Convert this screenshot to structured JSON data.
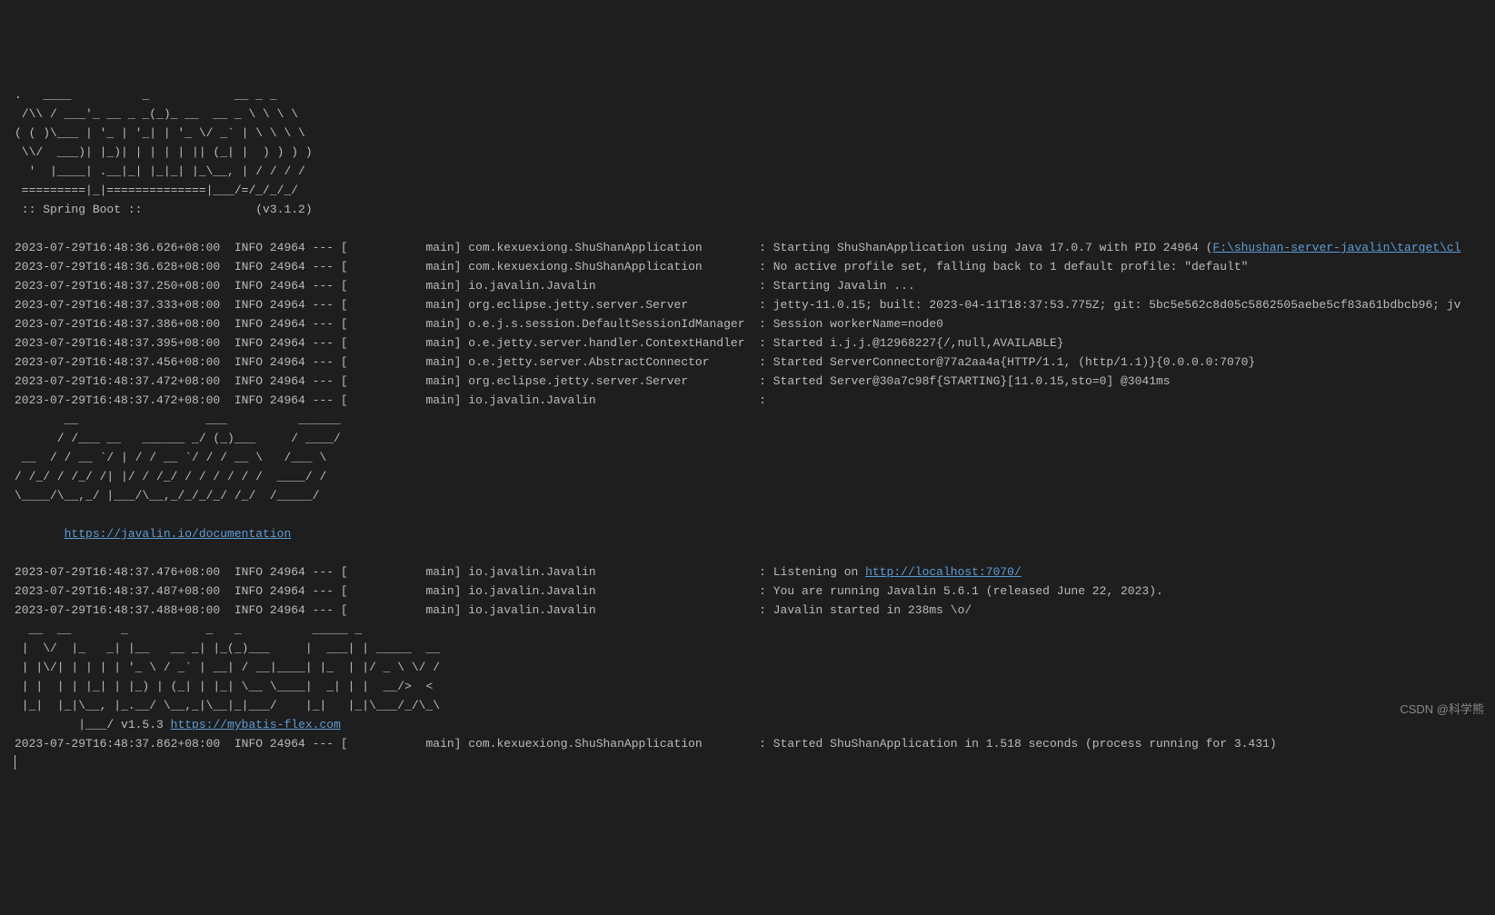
{
  "banner_spring_top": ".   ____          _            __ _ _\n /\\\\ / ___'_ __ _ _(_)_ __  __ _ \\ \\ \\ \\\n( ( )\\___ | '_ | '_| | '_ \\/ _` | \\ \\ \\ \\\n \\\\/  ___)| |_)| | | | | || (_| |  ) ) ) )\n  '  |____| .__|_| |_|_| |_\\__, | / / / /\n =========|_|==============|___/=/_/_/_/",
  "banner_spring_version": " :: Spring Boot ::                (v3.1.2)",
  "log_line_1_prefix": "2023-07-29T16:48:36.626+08:00  INFO 24964 --- [           main] com.kexuexiong.ShuShanApplication        : Starting ShuShanApplication using Java 17.0.7 with PID 24964 (",
  "log_line_1_link": "F:\\shushan-server-javalin\\target\\cl",
  "log_line_2": "2023-07-29T16:48:36.628+08:00  INFO 24964 --- [           main] com.kexuexiong.ShuShanApplication        : No active profile set, falling back to 1 default profile: \"default\"",
  "log_line_3": "2023-07-29T16:48:37.250+08:00  INFO 24964 --- [           main] io.javalin.Javalin                       : Starting Javalin ...",
  "log_line_4": "2023-07-29T16:48:37.333+08:00  INFO 24964 --- [           main] org.eclipse.jetty.server.Server          : jetty-11.0.15; built: 2023-04-11T18:37:53.775Z; git: 5bc5e562c8d05c5862505aebe5cf83a61bdbcb96; jv",
  "log_line_5": "2023-07-29T16:48:37.386+08:00  INFO 24964 --- [           main] o.e.j.s.session.DefaultSessionIdManager  : Session workerName=node0",
  "log_line_6": "2023-07-29T16:48:37.395+08:00  INFO 24964 --- [           main] o.e.jetty.server.handler.ContextHandler  : Started i.j.j.@12968227{/,null,AVAILABLE}",
  "log_line_7": "2023-07-29T16:48:37.456+08:00  INFO 24964 --- [           main] o.e.jetty.server.AbstractConnector       : Started ServerConnector@77a2aa4a{HTTP/1.1, (http/1.1)}{0.0.0.0:7070}",
  "log_line_8": "2023-07-29T16:48:37.472+08:00  INFO 24964 --- [           main] org.eclipse.jetty.server.Server          : Started Server@30a7c98f{STARTING}[11.0.15,sto=0] @3041ms",
  "log_line_9": "2023-07-29T16:48:37.472+08:00  INFO 24964 --- [           main] io.javalin.Javalin                       :",
  "banner_javalin": "       __                  ___          ______\n      / /___ __   ______ _/ (_)___     / ____/\n __  / / __ `/ | / / __ `/ / / __ \\   /___ \\\n/ /_/ / /_/ /| |/ / /_/ / / / / / /  ____/ /\n\\____/\\__,_/ |___/\\__,_/_/_/_/ /_/  /_____/",
  "javalin_doc_prefix": "       ",
  "javalin_doc_link": "https://javalin.io/documentation",
  "log_line_10_prefix": "2023-07-29T16:48:37.476+08:00  INFO 24964 --- [           main] io.javalin.Javalin                       : Listening on ",
  "log_line_10_link": "http://localhost:7070/",
  "log_line_11": "2023-07-29T16:48:37.487+08:00  INFO 24964 --- [           main] io.javalin.Javalin                       : You are running Javalin 5.6.1 (released June 22, 2023).",
  "log_line_12": "2023-07-29T16:48:37.488+08:00  INFO 24964 --- [           main] io.javalin.Javalin                       : Javalin started in 238ms \\o/",
  "banner_mybatis": "  __  __       _           _   _          _____ _\n |  \\/  |_   _| |__   __ _| |_(_)___     |  ___| | _____  __\n | |\\/| | | | | '_ \\ / _` | __| / __|____| |_  | |/ _ \\ \\/ /\n | |  | | |_| | |_) | (_| | |_| \\__ \\____|  _| | |  __/>  <\n |_|  |_|\\__, |_.__/ \\__,_|\\__|_|___/    |_|   |_|\\___/_/\\_\\\n         |___/ v1.5.3 ",
  "mybatis_link": "https://mybatis-flex.com",
  "log_line_13": "2023-07-29T16:48:37.862+08:00  INFO 24964 --- [           main] com.kexuexiong.ShuShanApplication        : Started ShuShanApplication in 1.518 seconds (process running for 3.431)",
  "watermark": "CSDN @科学熊"
}
